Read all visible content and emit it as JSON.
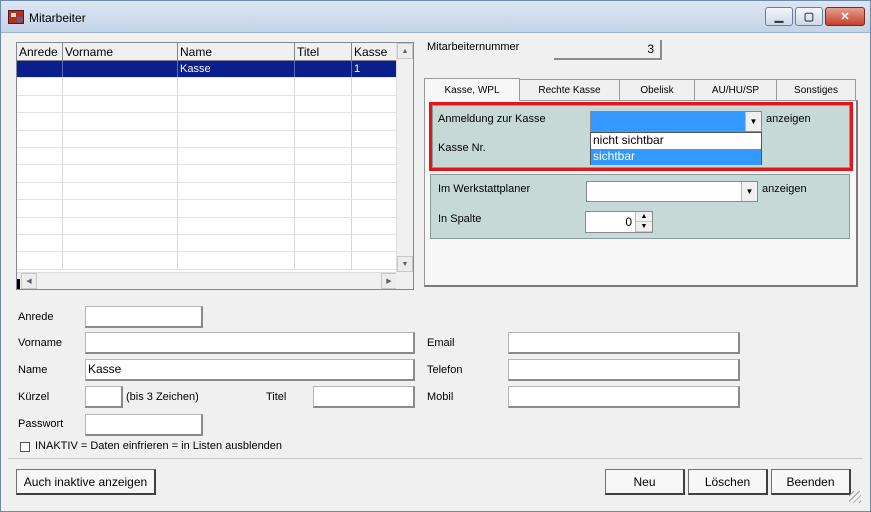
{
  "window": {
    "title": "Mitarbeiter"
  },
  "grid": {
    "columns": [
      "Anrede",
      "Vorname",
      "Name",
      "Titel",
      "Kasse"
    ],
    "rows": [
      [
        "",
        "",
        "Kasse",
        "",
        "1"
      ]
    ],
    "empty_row_count": 11,
    "selected_row": 0
  },
  "mitarbeiternummer": {
    "label": "Mitarbeiternummer",
    "value": "3"
  },
  "tabs": [
    {
      "label": "Kasse, WPL",
      "active": true
    },
    {
      "label": "Rechte Kasse",
      "active": false
    },
    {
      "label": "Obelisk",
      "active": false
    },
    {
      "label": "AU/HU/SP",
      "active": false
    },
    {
      "label": "Sonstiges",
      "active": false
    }
  ],
  "kasse_group": {
    "anmeldung_label": "Anmeldung zur Kasse",
    "anmeldung_suffix": "anzeigen",
    "kasse_nr_label": "Kasse Nr.",
    "dropdown_options": [
      "nicht sichtbar",
      "sichtbar"
    ],
    "dropdown_selected": "sichtbar"
  },
  "werkstatt_group": {
    "planer_label": "Im Werkstattplaner",
    "planer_suffix": "anzeigen",
    "spalte_label": "In Spalte",
    "spalte_value": "0"
  },
  "form": {
    "anrede_label": "Anrede",
    "anrede_value": "",
    "vorname_label": "Vorname",
    "vorname_value": "",
    "name_label": "Name",
    "name_value": "Kasse",
    "kuerzel_label": "Kürzel",
    "kuerzel_value": "",
    "kuerzel_hint": "(bis 3 Zeichen)",
    "titel_label": "Titel",
    "titel_value": "",
    "passwort_label": "Passwort",
    "passwort_value": "",
    "email_label": "Email",
    "email_value": "",
    "telefon_label": "Telefon",
    "telefon_value": "",
    "mobil_label": "Mobil",
    "mobil_value": "",
    "inaktiv_label": "INAKTIV = Daten einfrieren = in Listen ausblenden",
    "inaktiv_checked": false
  },
  "buttons": {
    "show_inactive": "Auch inaktive anzeigen",
    "neu": "Neu",
    "loeschen": "Löschen",
    "beenden": "Beenden"
  },
  "colors": {
    "selection": "#0a1e8c",
    "dropdown_highlight": "#3399ff",
    "group_bg": "#c6d9d6",
    "highlight_frame": "#e3161c"
  }
}
